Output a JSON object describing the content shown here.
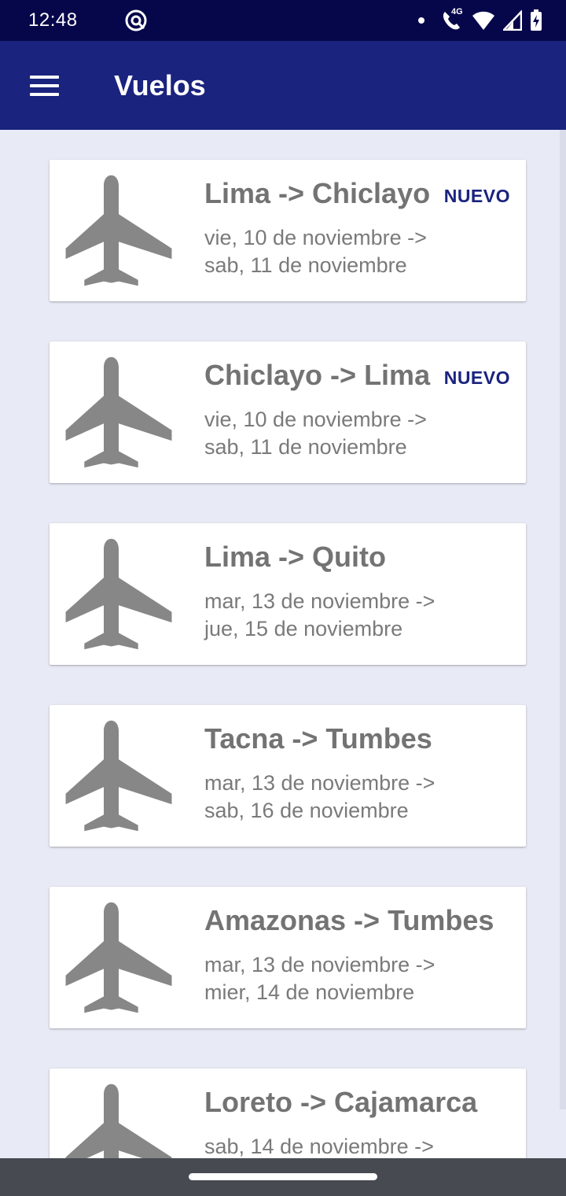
{
  "status_bar": {
    "time": "12:48",
    "network": "4G",
    "icons": [
      "at-sign-icon",
      "notification-dot-icon",
      "wifi-calling-icon",
      "wifi-icon",
      "signal-icon",
      "battery-charging-icon"
    ]
  },
  "app_bar": {
    "title": "Vuelos",
    "menu_icon": "hamburger-menu-icon"
  },
  "colors": {
    "status_bar": "#06064a",
    "app_bar": "#1a237e",
    "background": "#e8eaf6",
    "card": "#ffffff",
    "icon_gray": "#878787",
    "badge": "#1a237e",
    "nav_bar": "#474a51"
  },
  "flights": [
    {
      "route": "Lima -> Chiclayo",
      "badge": "NUEVO",
      "date_from": "vie, 10 de noviembre ->",
      "date_to": "sab, 11 de noviembre",
      "icon": "airplane-icon"
    },
    {
      "route": "Chiclayo -> Lima",
      "badge": "NUEVO",
      "date_from": "vie, 10 de noviembre ->",
      "date_to": "sab, 11 de noviembre",
      "icon": "airplane-icon"
    },
    {
      "route": "Lima -> Quito",
      "badge": "",
      "date_from": "mar, 13 de noviembre ->",
      "date_to": "jue, 15 de noviembre",
      "icon": "airplane-icon"
    },
    {
      "route": "Tacna -> Tumbes",
      "badge": "",
      "date_from": "mar, 13 de noviembre ->",
      "date_to": "sab, 16 de noviembre",
      "icon": "airplane-icon"
    },
    {
      "route": "Amazonas -> Tumbes",
      "badge": "",
      "date_from": "mar, 13 de noviembre ->",
      "date_to": "mier, 14 de noviembre",
      "icon": "airplane-icon"
    },
    {
      "route": "Loreto -> Cajamarca",
      "badge": "",
      "date_from": "sab, 14 de noviembre ->",
      "date_to": "",
      "icon": "airplane-icon"
    }
  ]
}
